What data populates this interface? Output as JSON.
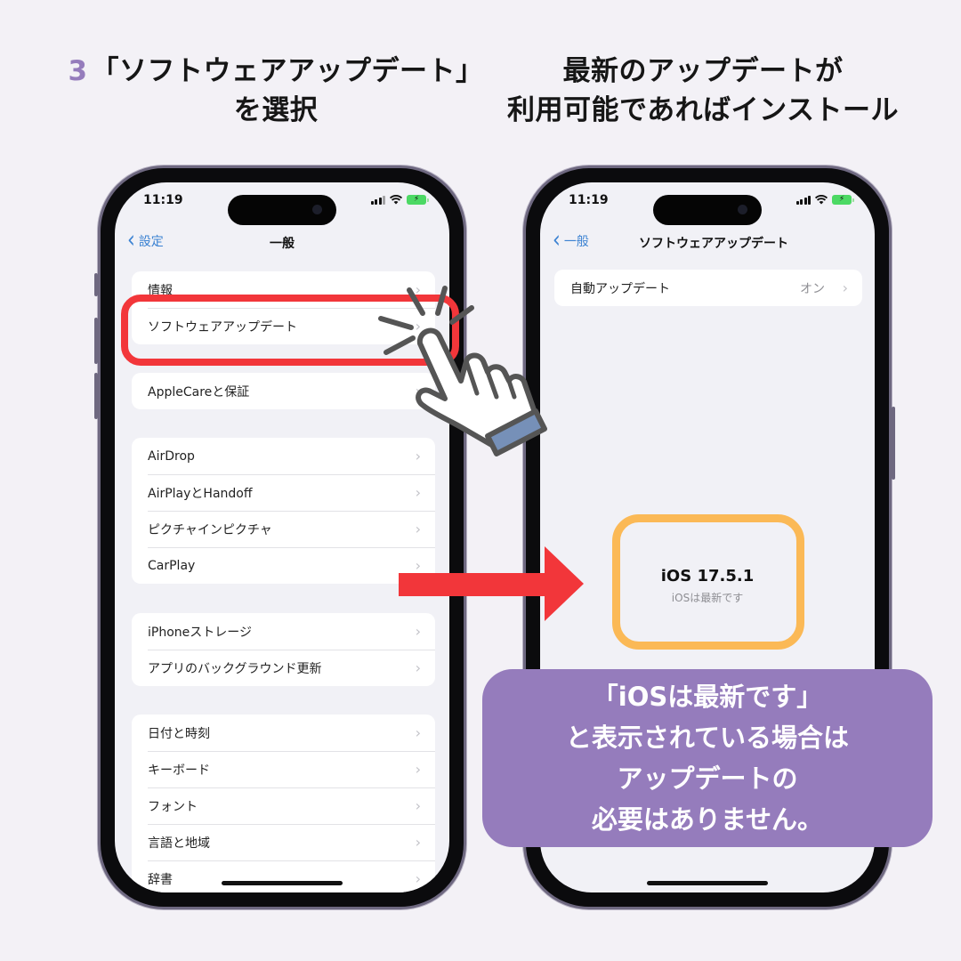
{
  "headings": {
    "left": {
      "step_number": "3",
      "line1": "「ソフトウェアアップデート」",
      "line2": "を選択"
    },
    "right": {
      "line1": "最新のアップデートが",
      "line2": "利用可能であればインストール"
    }
  },
  "phone_left": {
    "status": {
      "time": "11:19",
      "icons": [
        "cellular-signal-icon",
        "wifi-icon",
        "battery-charging-icon"
      ]
    },
    "nav": {
      "back_label": "設定",
      "title": "一般"
    },
    "groups": [
      {
        "items": [
          {
            "label": "情報"
          },
          {
            "label": "ソフトウェアアップデート",
            "highlighted": true
          }
        ]
      },
      {
        "items": [
          {
            "label": "AppleCareと保証"
          }
        ]
      },
      {
        "items": [
          {
            "label": "AirDrop"
          },
          {
            "label": "AirPlayとHandoff"
          },
          {
            "label": "ピクチャインピクチャ"
          },
          {
            "label": "CarPlay"
          }
        ]
      },
      {
        "items": [
          {
            "label": "iPhoneストレージ"
          },
          {
            "label": "アプリのバックグラウンド更新"
          }
        ]
      },
      {
        "items": [
          {
            "label": "日付と時刻"
          },
          {
            "label": "キーボード"
          },
          {
            "label": "フォント"
          },
          {
            "label": "言語と地域"
          },
          {
            "label": "辞書"
          }
        ]
      }
    ]
  },
  "phone_right": {
    "status": {
      "time": "11:19",
      "icons": [
        "cellular-signal-icon",
        "wifi-icon",
        "battery-charging-icon"
      ]
    },
    "nav": {
      "back_label": "一般",
      "title": "ソフトウェアアップデート"
    },
    "auto_update": {
      "label": "自動アップデート",
      "value": "オン"
    },
    "ios_version": "iOS 17.5.1",
    "ios_status": "iOSは最新です"
  },
  "callout": {
    "lines": [
      "「iOSは最新です」",
      "と表示されている場合は",
      "アップデートの",
      "必要はありません。"
    ]
  },
  "colors": {
    "accent_purple": "#957cbc",
    "highlight_red": "#f2363a",
    "highlight_orange": "#fbb956",
    "ios_link_blue": "#3b82d2"
  }
}
